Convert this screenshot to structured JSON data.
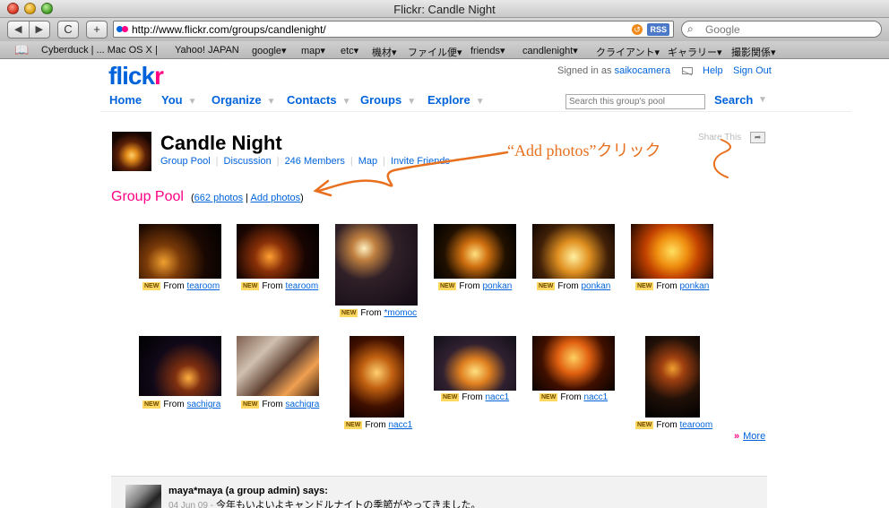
{
  "window": {
    "title": "Flickr: Candle Night"
  },
  "toolbar": {
    "back": "◀",
    "forward": "▶",
    "reload": "C",
    "add": "+",
    "url": "http://www.flickr.com/groups/candlenight/",
    "rss": "RSS",
    "google_placeholder": "Google"
  },
  "bookmarks": [
    "Cyberduck | ... Mac OS X |",
    "Yahoo! JAPAN",
    "google▾",
    "map▾",
    "etc▾",
    "機材▾",
    "ファイル便▾",
    "friends▾",
    "candlenight▾",
    "クライアント▾",
    "ギャラリー▾",
    "撮影関係▾"
  ],
  "header": {
    "logo_a": "flick",
    "logo_b": "r",
    "signed_in_prefix": "Signed in as ",
    "username": "saikocamera",
    "help": "Help",
    "sign_out": "Sign Out"
  },
  "nav": [
    "Home",
    "You",
    "Organize",
    "Contacts",
    "Groups",
    "Explore"
  ],
  "pool_search": {
    "placeholder": "Search this group's pool",
    "button": "Search"
  },
  "group": {
    "title": "Candle Night",
    "links": [
      "Group Pool",
      "Discussion",
      "246 Members",
      "Map",
      "Invite Friends"
    ],
    "share": "Share This"
  },
  "annotation": "“Add photos”クリック",
  "pool": {
    "title": "Group Pool",
    "open_paren": "(",
    "photo_count": "662 photos",
    "divider": "|",
    "add_photos": "Add photos",
    "close_paren": ")"
  },
  "photos": [
    {
      "author": "tearoom"
    },
    {
      "author": "tearoom"
    },
    {
      "author": "*momoc"
    },
    {
      "author": "ponkan"
    },
    {
      "author": "ponkan"
    },
    {
      "author": "ponkan"
    },
    {
      "author": "sachigra"
    },
    {
      "author": "sachigra"
    },
    {
      "author": "nacc1"
    },
    {
      "author": "nacc1"
    },
    {
      "author": "nacc1"
    },
    {
      "author": "tearoom"
    }
  ],
  "photo_labels": {
    "new": "NEW",
    "from": "From"
  },
  "more": {
    "chevron": "»",
    "label": "More"
  },
  "discussion": {
    "author": "maya*maya (a group admin) says:",
    "date": "04 Jun 09 -",
    "text": "今年もいよいよキャンドルナイトの季節がやってきました。"
  },
  "colors": {
    "flickr_blue": "#0063dc",
    "flickr_pink": "#ff0084",
    "annotation_orange": "#e8701e"
  }
}
